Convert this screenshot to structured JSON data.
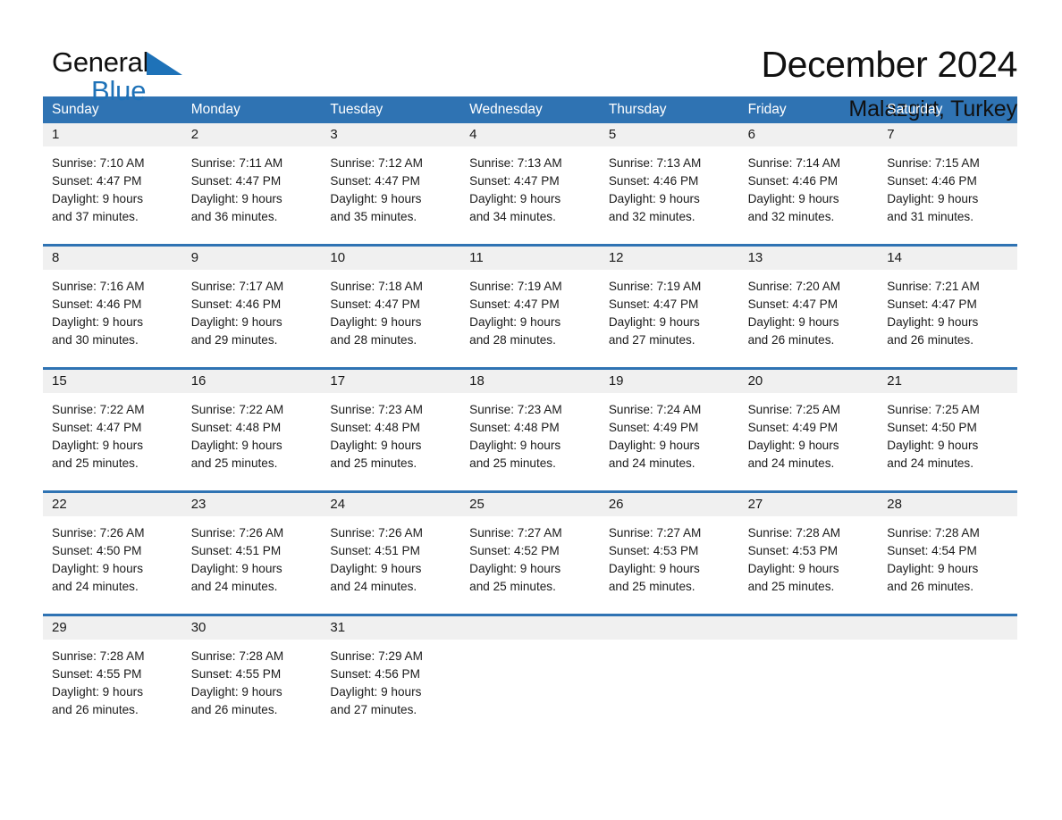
{
  "brand": {
    "name_part1": "General",
    "name_part2": "Blue",
    "flag_icon": "triangle-flag-icon",
    "accent_color": "#1e72b8"
  },
  "header": {
    "title": "December 2024",
    "subtitle": "Malazgirt, Turkey"
  },
  "calendar": {
    "header_bg": "#2f73b3",
    "day_band_bg": "#f0f0f0",
    "weekdays": [
      "Sunday",
      "Monday",
      "Tuesday",
      "Wednesday",
      "Thursday",
      "Friday",
      "Saturday"
    ],
    "weeks": [
      {
        "days": [
          {
            "date": "1",
            "sunrise": "Sunrise: 7:10 AM",
            "sunset": "Sunset: 4:47 PM",
            "daylight_line1": "Daylight: 9 hours",
            "daylight_line2": "and 37 minutes."
          },
          {
            "date": "2",
            "sunrise": "Sunrise: 7:11 AM",
            "sunset": "Sunset: 4:47 PM",
            "daylight_line1": "Daylight: 9 hours",
            "daylight_line2": "and 36 minutes."
          },
          {
            "date": "3",
            "sunrise": "Sunrise: 7:12 AM",
            "sunset": "Sunset: 4:47 PM",
            "daylight_line1": "Daylight: 9 hours",
            "daylight_line2": "and 35 minutes."
          },
          {
            "date": "4",
            "sunrise": "Sunrise: 7:13 AM",
            "sunset": "Sunset: 4:47 PM",
            "daylight_line1": "Daylight: 9 hours",
            "daylight_line2": "and 34 minutes."
          },
          {
            "date": "5",
            "sunrise": "Sunrise: 7:13 AM",
            "sunset": "Sunset: 4:46 PM",
            "daylight_line1": "Daylight: 9 hours",
            "daylight_line2": "and 32 minutes."
          },
          {
            "date": "6",
            "sunrise": "Sunrise: 7:14 AM",
            "sunset": "Sunset: 4:46 PM",
            "daylight_line1": "Daylight: 9 hours",
            "daylight_line2": "and 32 minutes."
          },
          {
            "date": "7",
            "sunrise": "Sunrise: 7:15 AM",
            "sunset": "Sunset: 4:46 PM",
            "daylight_line1": "Daylight: 9 hours",
            "daylight_line2": "and 31 minutes."
          }
        ]
      },
      {
        "days": [
          {
            "date": "8",
            "sunrise": "Sunrise: 7:16 AM",
            "sunset": "Sunset: 4:46 PM",
            "daylight_line1": "Daylight: 9 hours",
            "daylight_line2": "and 30 minutes."
          },
          {
            "date": "9",
            "sunrise": "Sunrise: 7:17 AM",
            "sunset": "Sunset: 4:46 PM",
            "daylight_line1": "Daylight: 9 hours",
            "daylight_line2": "and 29 minutes."
          },
          {
            "date": "10",
            "sunrise": "Sunrise: 7:18 AM",
            "sunset": "Sunset: 4:47 PM",
            "daylight_line1": "Daylight: 9 hours",
            "daylight_line2": "and 28 minutes."
          },
          {
            "date": "11",
            "sunrise": "Sunrise: 7:19 AM",
            "sunset": "Sunset: 4:47 PM",
            "daylight_line1": "Daylight: 9 hours",
            "daylight_line2": "and 28 minutes."
          },
          {
            "date": "12",
            "sunrise": "Sunrise: 7:19 AM",
            "sunset": "Sunset: 4:47 PM",
            "daylight_line1": "Daylight: 9 hours",
            "daylight_line2": "and 27 minutes."
          },
          {
            "date": "13",
            "sunrise": "Sunrise: 7:20 AM",
            "sunset": "Sunset: 4:47 PM",
            "daylight_line1": "Daylight: 9 hours",
            "daylight_line2": "and 26 minutes."
          },
          {
            "date": "14",
            "sunrise": "Sunrise: 7:21 AM",
            "sunset": "Sunset: 4:47 PM",
            "daylight_line1": "Daylight: 9 hours",
            "daylight_line2": "and 26 minutes."
          }
        ]
      },
      {
        "days": [
          {
            "date": "15",
            "sunrise": "Sunrise: 7:22 AM",
            "sunset": "Sunset: 4:47 PM",
            "daylight_line1": "Daylight: 9 hours",
            "daylight_line2": "and 25 minutes."
          },
          {
            "date": "16",
            "sunrise": "Sunrise: 7:22 AM",
            "sunset": "Sunset: 4:48 PM",
            "daylight_line1": "Daylight: 9 hours",
            "daylight_line2": "and 25 minutes."
          },
          {
            "date": "17",
            "sunrise": "Sunrise: 7:23 AM",
            "sunset": "Sunset: 4:48 PM",
            "daylight_line1": "Daylight: 9 hours",
            "daylight_line2": "and 25 minutes."
          },
          {
            "date": "18",
            "sunrise": "Sunrise: 7:23 AM",
            "sunset": "Sunset: 4:48 PM",
            "daylight_line1": "Daylight: 9 hours",
            "daylight_line2": "and 25 minutes."
          },
          {
            "date": "19",
            "sunrise": "Sunrise: 7:24 AM",
            "sunset": "Sunset: 4:49 PM",
            "daylight_line1": "Daylight: 9 hours",
            "daylight_line2": "and 24 minutes."
          },
          {
            "date": "20",
            "sunrise": "Sunrise: 7:25 AM",
            "sunset": "Sunset: 4:49 PM",
            "daylight_line1": "Daylight: 9 hours",
            "daylight_line2": "and 24 minutes."
          },
          {
            "date": "21",
            "sunrise": "Sunrise: 7:25 AM",
            "sunset": "Sunset: 4:50 PM",
            "daylight_line1": "Daylight: 9 hours",
            "daylight_line2": "and 24 minutes."
          }
        ]
      },
      {
        "days": [
          {
            "date": "22",
            "sunrise": "Sunrise: 7:26 AM",
            "sunset": "Sunset: 4:50 PM",
            "daylight_line1": "Daylight: 9 hours",
            "daylight_line2": "and 24 minutes."
          },
          {
            "date": "23",
            "sunrise": "Sunrise: 7:26 AM",
            "sunset": "Sunset: 4:51 PM",
            "daylight_line1": "Daylight: 9 hours",
            "daylight_line2": "and 24 minutes."
          },
          {
            "date": "24",
            "sunrise": "Sunrise: 7:26 AM",
            "sunset": "Sunset: 4:51 PM",
            "daylight_line1": "Daylight: 9 hours",
            "daylight_line2": "and 24 minutes."
          },
          {
            "date": "25",
            "sunrise": "Sunrise: 7:27 AM",
            "sunset": "Sunset: 4:52 PM",
            "daylight_line1": "Daylight: 9 hours",
            "daylight_line2": "and 25 minutes."
          },
          {
            "date": "26",
            "sunrise": "Sunrise: 7:27 AM",
            "sunset": "Sunset: 4:53 PM",
            "daylight_line1": "Daylight: 9 hours",
            "daylight_line2": "and 25 minutes."
          },
          {
            "date": "27",
            "sunrise": "Sunrise: 7:28 AM",
            "sunset": "Sunset: 4:53 PM",
            "daylight_line1": "Daylight: 9 hours",
            "daylight_line2": "and 25 minutes."
          },
          {
            "date": "28",
            "sunrise": "Sunrise: 7:28 AM",
            "sunset": "Sunset: 4:54 PM",
            "daylight_line1": "Daylight: 9 hours",
            "daylight_line2": "and 26 minutes."
          }
        ]
      },
      {
        "days": [
          {
            "date": "29",
            "sunrise": "Sunrise: 7:28 AM",
            "sunset": "Sunset: 4:55 PM",
            "daylight_line1": "Daylight: 9 hours",
            "daylight_line2": "and 26 minutes."
          },
          {
            "date": "30",
            "sunrise": "Sunrise: 7:28 AM",
            "sunset": "Sunset: 4:55 PM",
            "daylight_line1": "Daylight: 9 hours",
            "daylight_line2": "and 26 minutes."
          },
          {
            "date": "31",
            "sunrise": "Sunrise: 7:29 AM",
            "sunset": "Sunset: 4:56 PM",
            "daylight_line1": "Daylight: 9 hours",
            "daylight_line2": "and 27 minutes."
          },
          {
            "date": "",
            "sunrise": "",
            "sunset": "",
            "daylight_line1": "",
            "daylight_line2": ""
          },
          {
            "date": "",
            "sunrise": "",
            "sunset": "",
            "daylight_line1": "",
            "daylight_line2": ""
          },
          {
            "date": "",
            "sunrise": "",
            "sunset": "",
            "daylight_line1": "",
            "daylight_line2": ""
          },
          {
            "date": "",
            "sunrise": "",
            "sunset": "",
            "daylight_line1": "",
            "daylight_line2": ""
          }
        ]
      }
    ]
  }
}
